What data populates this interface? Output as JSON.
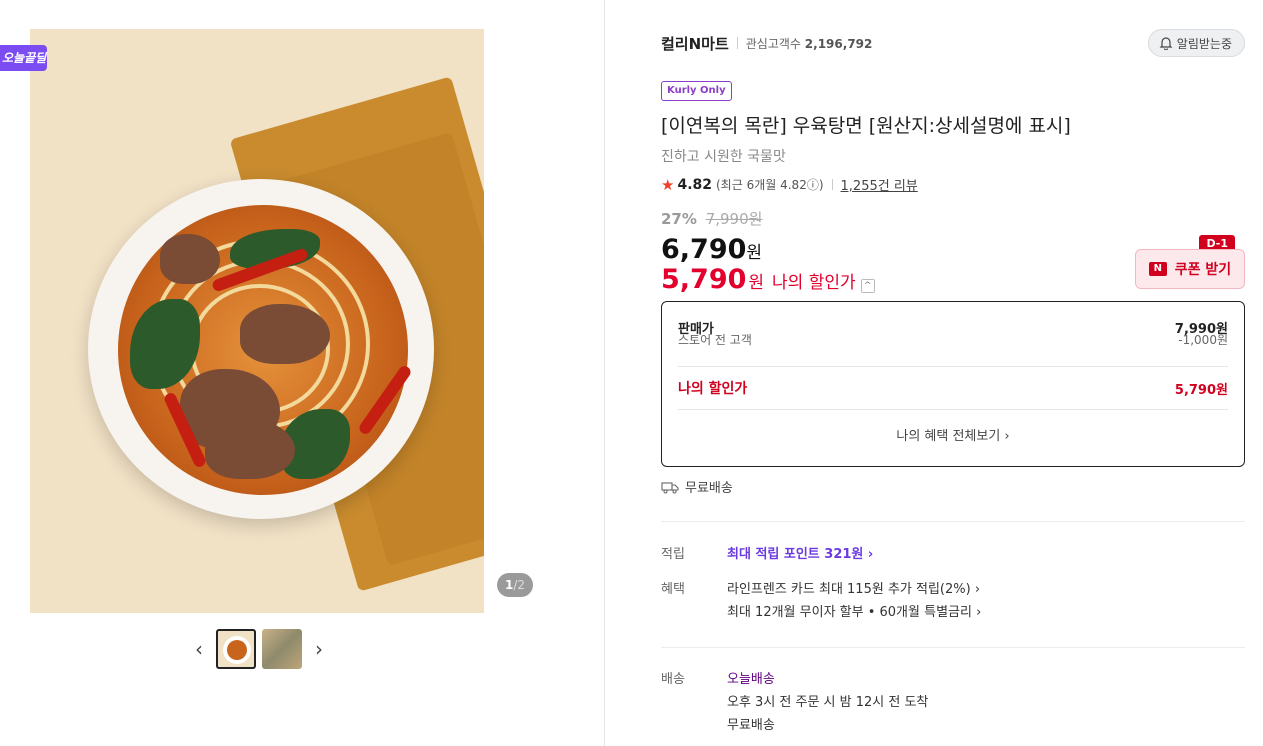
{
  "gallery": {
    "deal_tag": "오늘끝딜",
    "page_current": "1",
    "page_total": "/2",
    "prev_label": "‹",
    "next_label": "›"
  },
  "store": {
    "name": "컬리N마트",
    "fans_label": "관심고객수",
    "fans_count": "2,196,792",
    "notify_label": "알림받는중"
  },
  "product": {
    "badge": "Kurly Only",
    "title": "[이연복의 목란] 우육탕면 [원산지:상세설명에 표시]",
    "subtitle": "진하고 시원한 국물맛",
    "rating": "4.82",
    "rating_recent": "(최근 6개월 4.82ⓘ)",
    "reviews": "1,255건 리뷰",
    "discount_rate": "27%",
    "original_price": "7,990원",
    "price": "6,790",
    "price_unit": "원",
    "my_price": "5,790",
    "my_price_unit": "원",
    "my_price_label": "나의 할인가",
    "caret": "^"
  },
  "coupon": {
    "label": "쿠폰 받기",
    "badge": "D-1",
    "icon": "N"
  },
  "price_box": {
    "sale_label": "판매가",
    "sale_value": "7,990원",
    "store_label": "스토어 전 고객",
    "store_value": "-1,000원",
    "mine_label": "나의 할인가",
    "mine_value": "5,790원",
    "more_label": "나의 혜택 전체보기 ›"
  },
  "shipping": {
    "free_label": "무료배송"
  },
  "points": {
    "label": "적립",
    "value": "최대 적립 포인트 321원 ›"
  },
  "benefits": {
    "label": "혜택",
    "line1": "라인프렌즈 카드 최대 115원 추가 적립(2%) ›",
    "line2": "최대 12개월 무이자 할부 • 60개월 특별금리 ›"
  },
  "delivery": {
    "label": "배송",
    "title": "오늘배송",
    "line1": "오후 3시 전 주문 시 밤 12시 전 도착",
    "line2": "무료배송"
  },
  "colors": {
    "accent_red": "#e3002d",
    "purple": "#6b3be0",
    "kurly_purple": "#5f0080"
  }
}
